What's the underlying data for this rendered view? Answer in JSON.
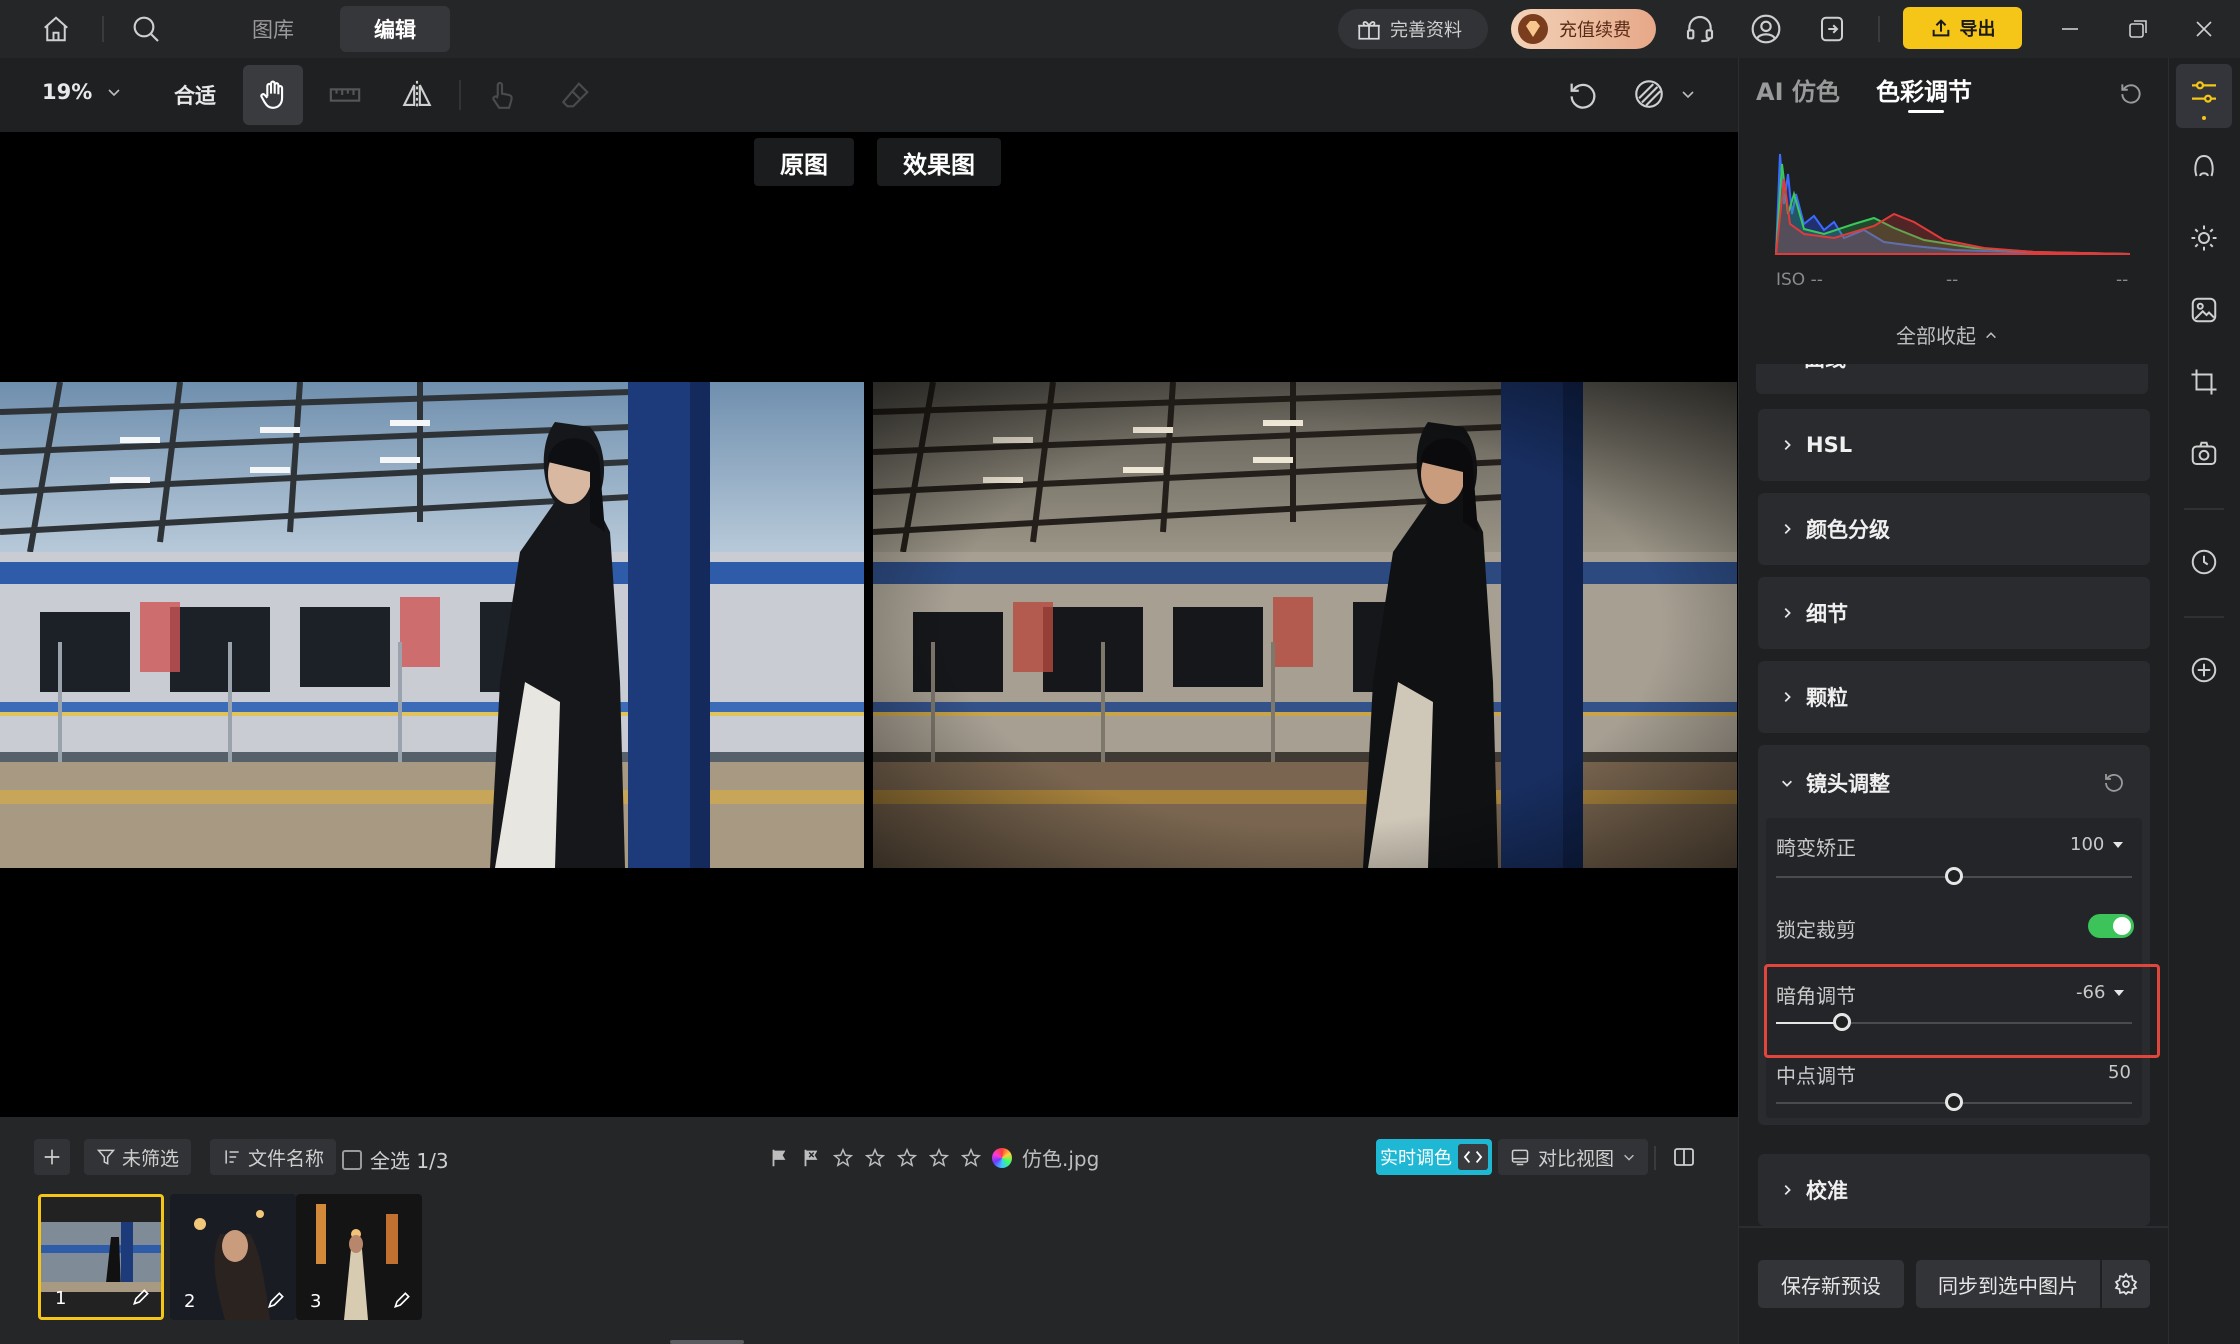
{
  "topbar": {
    "tabs": [
      {
        "label": "图库"
      },
      {
        "label": "编辑"
      }
    ],
    "complete_profile": "完善资料",
    "recharge": "充值续费",
    "export": "导出"
  },
  "toolbar": {
    "zoom": "19%",
    "fit": "合适"
  },
  "compare": {
    "original": "原图",
    "effect": "效果图"
  },
  "bottombar": {
    "unfiltered": "未筛选",
    "filename": "文件名称",
    "select_all": "全选 1/3",
    "file": "仿色.jpg",
    "live_color": "实时调色",
    "compare_view": "对比视图",
    "thumbnails": [
      {
        "num": "1"
      },
      {
        "num": "2"
      },
      {
        "num": "3"
      }
    ]
  },
  "panel": {
    "tab_ai": "AI 仿色",
    "tab_color": "色彩调节",
    "histogram": {
      "iso": "ISO --",
      "mid": "--",
      "right": "--"
    },
    "collapse_all": "全部收起",
    "sections": {
      "curve": "曲线",
      "hsl": "HSL",
      "color_grading": "颜色分级",
      "detail": "细节",
      "grain": "颗粒",
      "lens": "镜头调整",
      "calibration": "校准"
    },
    "lens": {
      "distortion": {
        "label": "畸变矫正",
        "value": "100"
      },
      "lock_crop": {
        "label": "锁定裁剪",
        "on": true
      },
      "vignette": {
        "label": "暗角调节",
        "value": "-66"
      },
      "midpoint": {
        "label": "中点调节",
        "value": "50"
      }
    },
    "save_preset": "保存新预设",
    "sync": "同步到选中图片"
  },
  "colors": {
    "accent_yellow": "#f5c518",
    "toggle_green": "#3cc35a",
    "highlight_red": "#e0463c",
    "live_cyan": "#1fb8d4"
  }
}
